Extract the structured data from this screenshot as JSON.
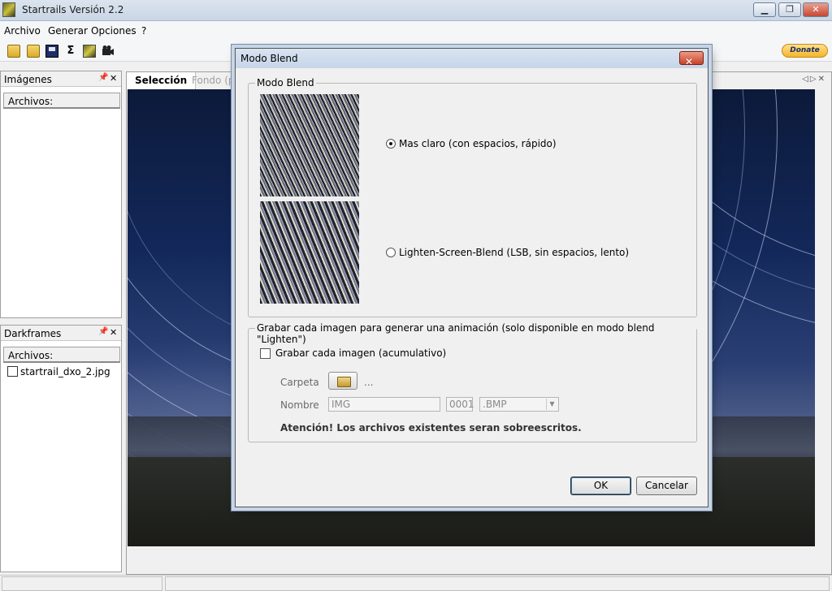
{
  "app": {
    "title": "Startrails Versión 2.2"
  },
  "menu": {
    "items": [
      "Archivo",
      "Generar",
      "Opciones",
      "?"
    ]
  },
  "toolbar": {
    "icons": [
      "open-folder-icon",
      "open-multiple-icon",
      "save-icon",
      "sum-icon",
      "startrails-icon",
      "video-icon"
    ],
    "sum_glyph": "Σ",
    "donate_label": "Donate"
  },
  "panels": {
    "images": {
      "title": "Imágenes",
      "column_header": "Archivos:",
      "files": []
    },
    "darkframes": {
      "title": "Darkframes",
      "column_header": "Archivos:",
      "files": [
        "startrail_dxo_2.jpg"
      ]
    }
  },
  "main": {
    "tabs": [
      {
        "label": "Selección",
        "active": true
      },
      {
        "label": "Fondo (pro",
        "active": false
      }
    ]
  },
  "dialog": {
    "title": "Modo Blend",
    "blend_group": {
      "legend": "Modo Blend",
      "options": [
        {
          "label": "Mas claro (con espacios, rápido)",
          "checked": true
        },
        {
          "label": "Lighten-Screen-Blend (LSB, sin espacios, lento)",
          "checked": false
        }
      ]
    },
    "animation_group": {
      "legend": "Grabar cada imagen para generar una animación (solo disponible en modo blend \"Lighten\")",
      "checkbox_label": "Grabar cada imagen (acumulativo)",
      "checkbox_checked": false,
      "folder_label": "Carpeta",
      "folder_value": "...",
      "name_label": "Nombre",
      "name_value": "IMG",
      "number_value": "0001",
      "format_value": ".BMP",
      "warning": "Atención! Los archivos existentes seran sobreescritos."
    },
    "ok_label": "OK",
    "cancel_label": "Cancelar"
  }
}
